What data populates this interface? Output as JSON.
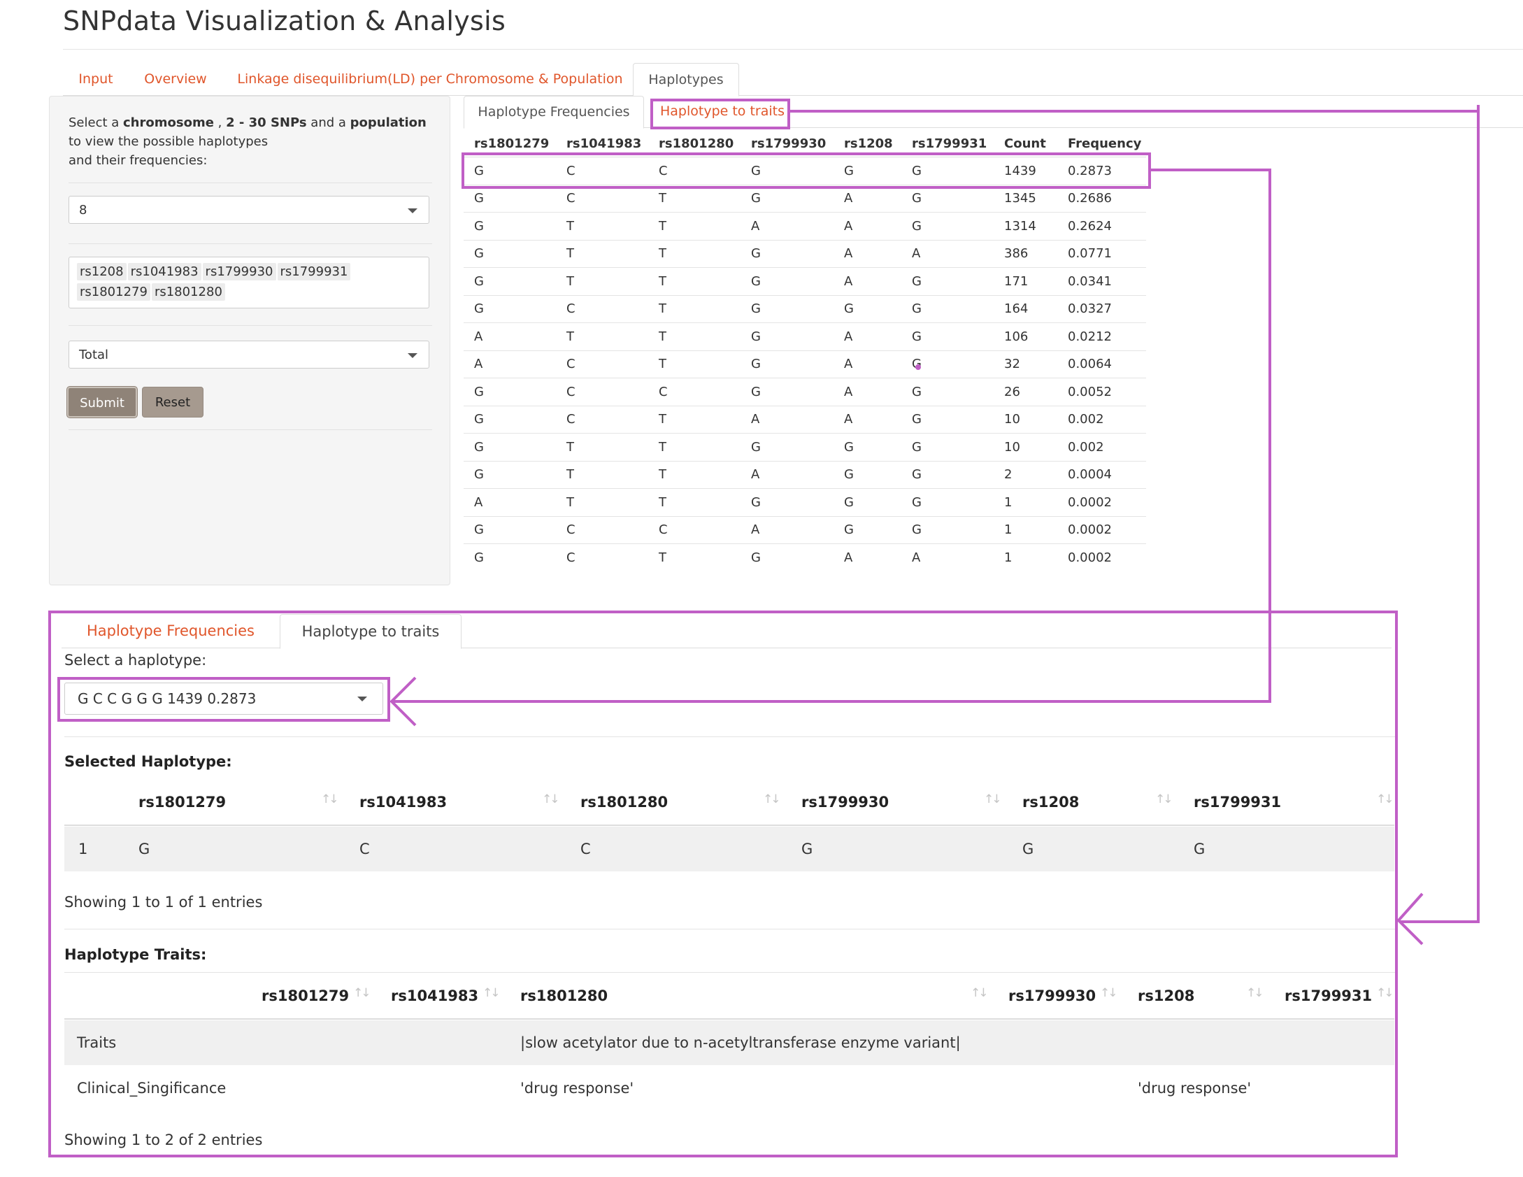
{
  "app": {
    "title": "SNPdata Visualization & Analysis"
  },
  "main_tabs": [
    {
      "label": "Input"
    },
    {
      "label": "Overview"
    },
    {
      "label": "Linkage disequilibrium(LD) per Chromosome & Population"
    },
    {
      "label": "Haplotypes"
    }
  ],
  "sidebar": {
    "instr": {
      "p1": "Select a ",
      "b1": "chromosome",
      "p2": " , ",
      "b2": "2 - 30 SNPs",
      "p3": " and a ",
      "b3": "population",
      "line2": "to view the possible haplotypes",
      "line3": "and their frequencies:"
    },
    "chromosome": "8",
    "snps": [
      "rs1208",
      "rs1041983",
      "rs1799930",
      "rs1799931",
      "rs1801279",
      "rs1801280"
    ],
    "population": "Total",
    "submit_label": "Submit",
    "reset_label": "Reset"
  },
  "sub_tabs": [
    {
      "label": "Haplotype Frequencies"
    },
    {
      "label": "Haplotype to traits"
    }
  ],
  "freq_table": {
    "headers": [
      "rs1801279",
      "rs1041983",
      "rs1801280",
      "rs1799930",
      "rs1208",
      "rs1799931",
      "Count",
      "Frequency"
    ],
    "rows": [
      [
        "G",
        "C",
        "C",
        "G",
        "G",
        "G",
        "1439",
        "0.2873"
      ],
      [
        "G",
        "C",
        "T",
        "G",
        "A",
        "G",
        "1345",
        "0.2686"
      ],
      [
        "G",
        "T",
        "T",
        "A",
        "A",
        "G",
        "1314",
        "0.2624"
      ],
      [
        "G",
        "T",
        "T",
        "G",
        "A",
        "A",
        "386",
        "0.0771"
      ],
      [
        "G",
        "T",
        "T",
        "G",
        "A",
        "G",
        "171",
        "0.0341"
      ],
      [
        "G",
        "C",
        "T",
        "G",
        "G",
        "G",
        "164",
        "0.0327"
      ],
      [
        "A",
        "T",
        "T",
        "G",
        "A",
        "G",
        "106",
        "0.0212"
      ],
      [
        "A",
        "C",
        "T",
        "G",
        "A",
        "G",
        "32",
        "0.0064"
      ],
      [
        "G",
        "C",
        "C",
        "G",
        "A",
        "G",
        "26",
        "0.0052"
      ],
      [
        "G",
        "C",
        "T",
        "A",
        "A",
        "G",
        "10",
        "0.002"
      ],
      [
        "G",
        "T",
        "T",
        "G",
        "G",
        "G",
        "10",
        "0.002"
      ],
      [
        "G",
        "T",
        "T",
        "A",
        "G",
        "G",
        "2",
        "0.0004"
      ],
      [
        "A",
        "T",
        "T",
        "G",
        "G",
        "G",
        "1",
        "0.0002"
      ],
      [
        "G",
        "C",
        "C",
        "A",
        "G",
        "G",
        "1",
        "0.0002"
      ],
      [
        "G",
        "C",
        "T",
        "G",
        "A",
        "A",
        "1",
        "0.0002"
      ]
    ]
  },
  "lower": {
    "tabs": [
      {
        "label": "Haplotype Frequencies"
      },
      {
        "label": "Haplotype to traits"
      }
    ],
    "select_label": "Select a haplotype:",
    "selected_haplotype": "G C C G G G 1439 0.2873",
    "selected_title": "Selected Haplotype:",
    "selected_headers": [
      "rs1801279",
      "rs1041983",
      "rs1801280",
      "rs1799930",
      "rs1208",
      "rs1799931"
    ],
    "selected_row": {
      "index": "1",
      "values": [
        "G",
        "C",
        "C",
        "G",
        "G",
        "G"
      ]
    },
    "selected_info": "Showing 1 to 1 of 1 entries",
    "traits_title": "Haplotype Traits:",
    "traits_headers": [
      "rs1801279",
      "rs1041983",
      "rs1801280",
      "rs1799930",
      "rs1208",
      "rs1799931"
    ],
    "traits_rows": [
      {
        "label": "Traits",
        "rs1801280": "|slow acetylator due to n-acetyltransferase enzyme variant|",
        "rs1208": ""
      },
      {
        "label": "Clinical_Singificance",
        "rs1801280": "'drug response'",
        "rs1208": "'drug response'"
      }
    ],
    "traits_info": "Showing 1 to 2 of 2 entries"
  },
  "sort_icon": "sort-arrows-icon",
  "colors": {
    "accent": "#e0562b",
    "annotation": "#c05fc6",
    "submit": "#8f8378"
  }
}
